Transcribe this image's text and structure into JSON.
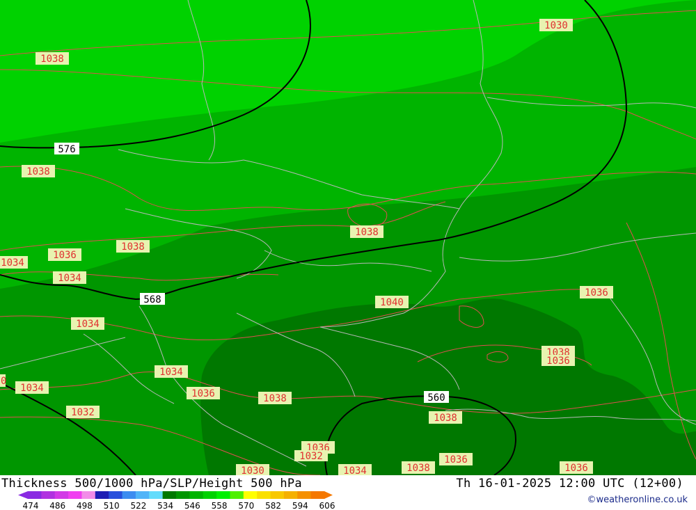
{
  "footer": {
    "title": "Thickness 500/1000 hPa/SLP/Height 500 hPa",
    "datetime": "Th 16-01-2025 12:00 UTC (12+00)",
    "credit": "©weatheronline.co.uk"
  },
  "colors": {
    "band_576_582": "#00d200",
    "band_570_576": "#00b400",
    "band_564_570": "#009600",
    "band_558_564": "#007800",
    "isobar": "#e05050",
    "height_contour": "#000000",
    "border": "#b0b0b0"
  },
  "color_scale": {
    "labels": [
      "474",
      "486",
      "498",
      "510",
      "522",
      "534",
      "546",
      "558",
      "570",
      "582",
      "594",
      "606"
    ],
    "colors": [
      "#8a2be2",
      "#b032e0",
      "#d23ae6",
      "#f040f0",
      "#f28ce8",
      "#1e1eb4",
      "#2850dc",
      "#3c8cf0",
      "#50b4f8",
      "#64dcfc",
      "#007800",
      "#009600",
      "#00b400",
      "#00d200",
      "#00f000",
      "#50f000",
      "#ffff00",
      "#fae000",
      "#f8c800",
      "#f5b000",
      "#f59000",
      "#f57800"
    ]
  },
  "height_labels": [
    "576",
    "568",
    "560"
  ],
  "slp_labels": {
    "l1": "1030",
    "l2": "1038",
    "l3": "1038",
    "l4": "1038",
    "l5": "1038",
    "l6": "1036",
    "l7": "1034",
    "l8": "1034",
    "l9": "1034",
    "l10": "1040",
    "l11": "1036",
    "l12": "1038",
    "l13": "1036",
    "l14": "1034",
    "l15": "1034",
    "l16": "1032",
    "l17": "1036",
    "l18": "1038",
    "l19": "1038",
    "l20": "1036",
    "l21": "1032",
    "l22": "1030",
    "l23": "1034",
    "l24": "1038",
    "l25": "1036",
    "l26": "1036",
    "l27": "0"
  }
}
